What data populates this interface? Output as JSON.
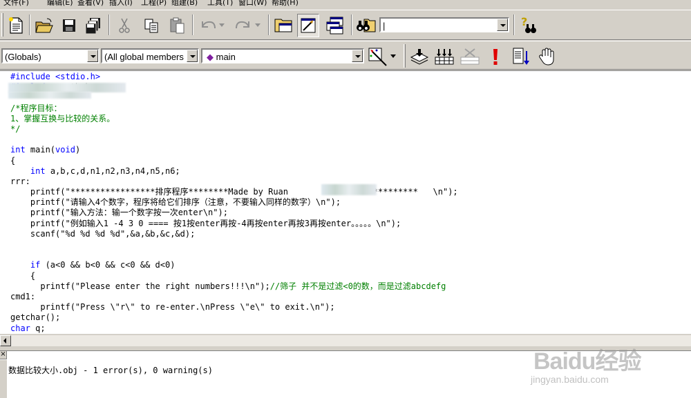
{
  "menu": [
    "文件(F)",
    "编辑(E)",
    "查看(V)",
    "插入(I)",
    "工程(P)",
    "组建(B)",
    "工具(T)",
    "窗口(W)",
    "帮助(H)"
  ],
  "toolbar": {
    "find_value": "|"
  },
  "wizardbar": {
    "class_combo": "(Globals)",
    "filter_combo": "(All global members",
    "member_combo": "main"
  },
  "code_lines": [
    [
      {
        "t": "#include <stdio.h>",
        "c": "kw"
      }
    ],
    [
      {
        "t": "#include <",
        "c": "kw"
      },
      {
        "t": "math.h>",
        "c": ""
      }
    ],
    [
      {
        "t": "",
        "c": ""
      }
    ],
    [
      {
        "t": "/*程序目标：",
        "c": "cm"
      }
    ],
    [
      {
        "t": "1、掌握互换与比较的关系。",
        "c": "cm"
      }
    ],
    [
      {
        "t": "*/",
        "c": "cm"
      }
    ],
    [
      {
        "t": "",
        "c": ""
      }
    ],
    [
      {
        "t": "int",
        "c": "kw"
      },
      {
        "t": " main(",
        "c": ""
      },
      {
        "t": "void",
        "c": "kw"
      },
      {
        "t": ")",
        "c": ""
      }
    ],
    [
      {
        "t": "{",
        "c": ""
      }
    ],
    [
      {
        "t": "    ",
        "c": ""
      },
      {
        "t": "int",
        "c": "kw"
      },
      {
        "t": " a,b,c,d,n1,n2,n3,n4,n5,n6;",
        "c": ""
      }
    ],
    [
      {
        "t": "rrr:",
        "c": ""
      }
    ],
    [
      {
        "t": "    printf(\"*****************排序程序********Made by Ruan          ****************   \\n\");",
        "c": ""
      }
    ],
    [
      {
        "t": "    printf(\"请输入4个数字，程序将给它们排序（注意，不要输入同样的数字）\\n\");",
        "c": ""
      }
    ],
    [
      {
        "t": "    printf(\"输入方法：输一个数字按一次enter\\n\");",
        "c": ""
      }
    ],
    [
      {
        "t": "    printf(\"例如输入1 -4 3 0 ==== 按1按enter再按-4再按enter再按3再按enter。。。。。\\n\");",
        "c": ""
      }
    ],
    [
      {
        "t": "    scanf(\"%d %d %d %d\",&a,&b,&c,&d);",
        "c": ""
      }
    ],
    [
      {
        "t": "",
        "c": ""
      }
    ],
    [
      {
        "t": "",
        "c": ""
      }
    ],
    [
      {
        "t": "    ",
        "c": ""
      },
      {
        "t": "if",
        "c": "kw"
      },
      {
        "t": " (a<0 && b<0 && c<0 && d<0)",
        "c": ""
      }
    ],
    [
      {
        "t": "    {",
        "c": ""
      }
    ],
    [
      {
        "t": "      printf(\"Please enter the right numbers!!!\\n\");",
        "c": ""
      },
      {
        "t": "//筛子 并不是过滤<0的数，而是过滤abcdefg",
        "c": "cm"
      }
    ],
    [
      {
        "t": "cmd1:",
        "c": ""
      }
    ],
    [
      {
        "t": "      printf(\"Press \\\"r\\\" to re-enter.\\nPress \\\"e\\\" to exit.\\n\");",
        "c": ""
      }
    ],
    [
      {
        "t": "getchar();",
        "c": ""
      }
    ],
    [
      {
        "t": "char",
        "c": "kw"
      },
      {
        "t": " q;",
        "c": ""
      }
    ]
  ],
  "output": {
    "message": "数据比较大小.obj - 1 error(s), 0 warning(s)",
    "close_glyph": "×"
  },
  "watermark": {
    "main": "Baidu经验",
    "sub": "jingyan.baidu.com"
  }
}
